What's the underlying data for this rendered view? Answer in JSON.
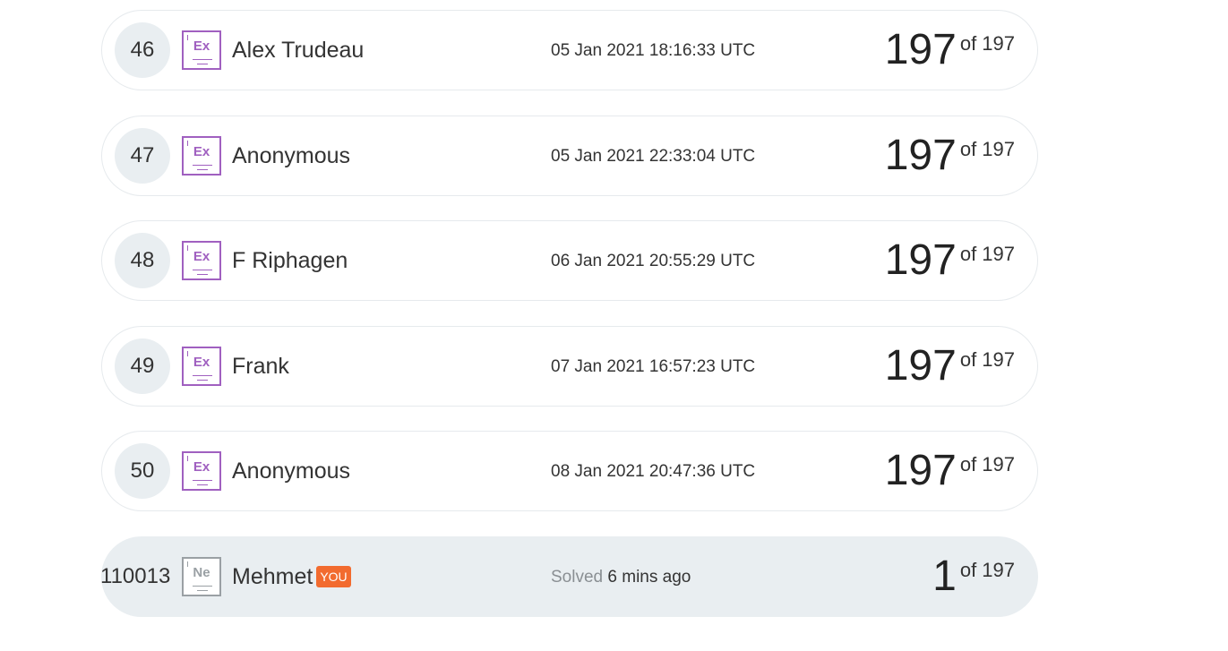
{
  "leaderboard": {
    "rows": [
      {
        "rank": "46",
        "badge": "Ex",
        "name": "Alex Trudeau",
        "date": "05 Jan 2021 18:16:33 UTC",
        "score": "197",
        "total": "of 197"
      },
      {
        "rank": "47",
        "badge": "Ex",
        "name": "Anonymous",
        "date": "05 Jan 2021 22:33:04 UTC",
        "score": "197",
        "total": "of 197"
      },
      {
        "rank": "48",
        "badge": "Ex",
        "name": "F Riphagen",
        "date": "06 Jan 2021 20:55:29 UTC",
        "score": "197",
        "total": "of 197"
      },
      {
        "rank": "49",
        "badge": "Ex",
        "name": "Frank",
        "date": "07 Jan 2021 16:57:23 UTC",
        "score": "197",
        "total": "of 197"
      },
      {
        "rank": "50",
        "badge": "Ex",
        "name": "Anonymous",
        "date": "08 Jan 2021 20:47:36 UTC",
        "score": "197",
        "total": "of 197"
      }
    ],
    "current_user": {
      "rank": "110013",
      "badge": "Ne",
      "name": "Mehmet",
      "you_label": "YOU",
      "solved_label": "Solved",
      "solved_time": "6 mins ago",
      "score": "1",
      "total": "of 197"
    }
  },
  "colors": {
    "expert_badge": "#a060c0",
    "newbie_badge": "#9aa0a4",
    "you_tag": "#f26b2f",
    "highlight_row": "#e9eef1"
  }
}
